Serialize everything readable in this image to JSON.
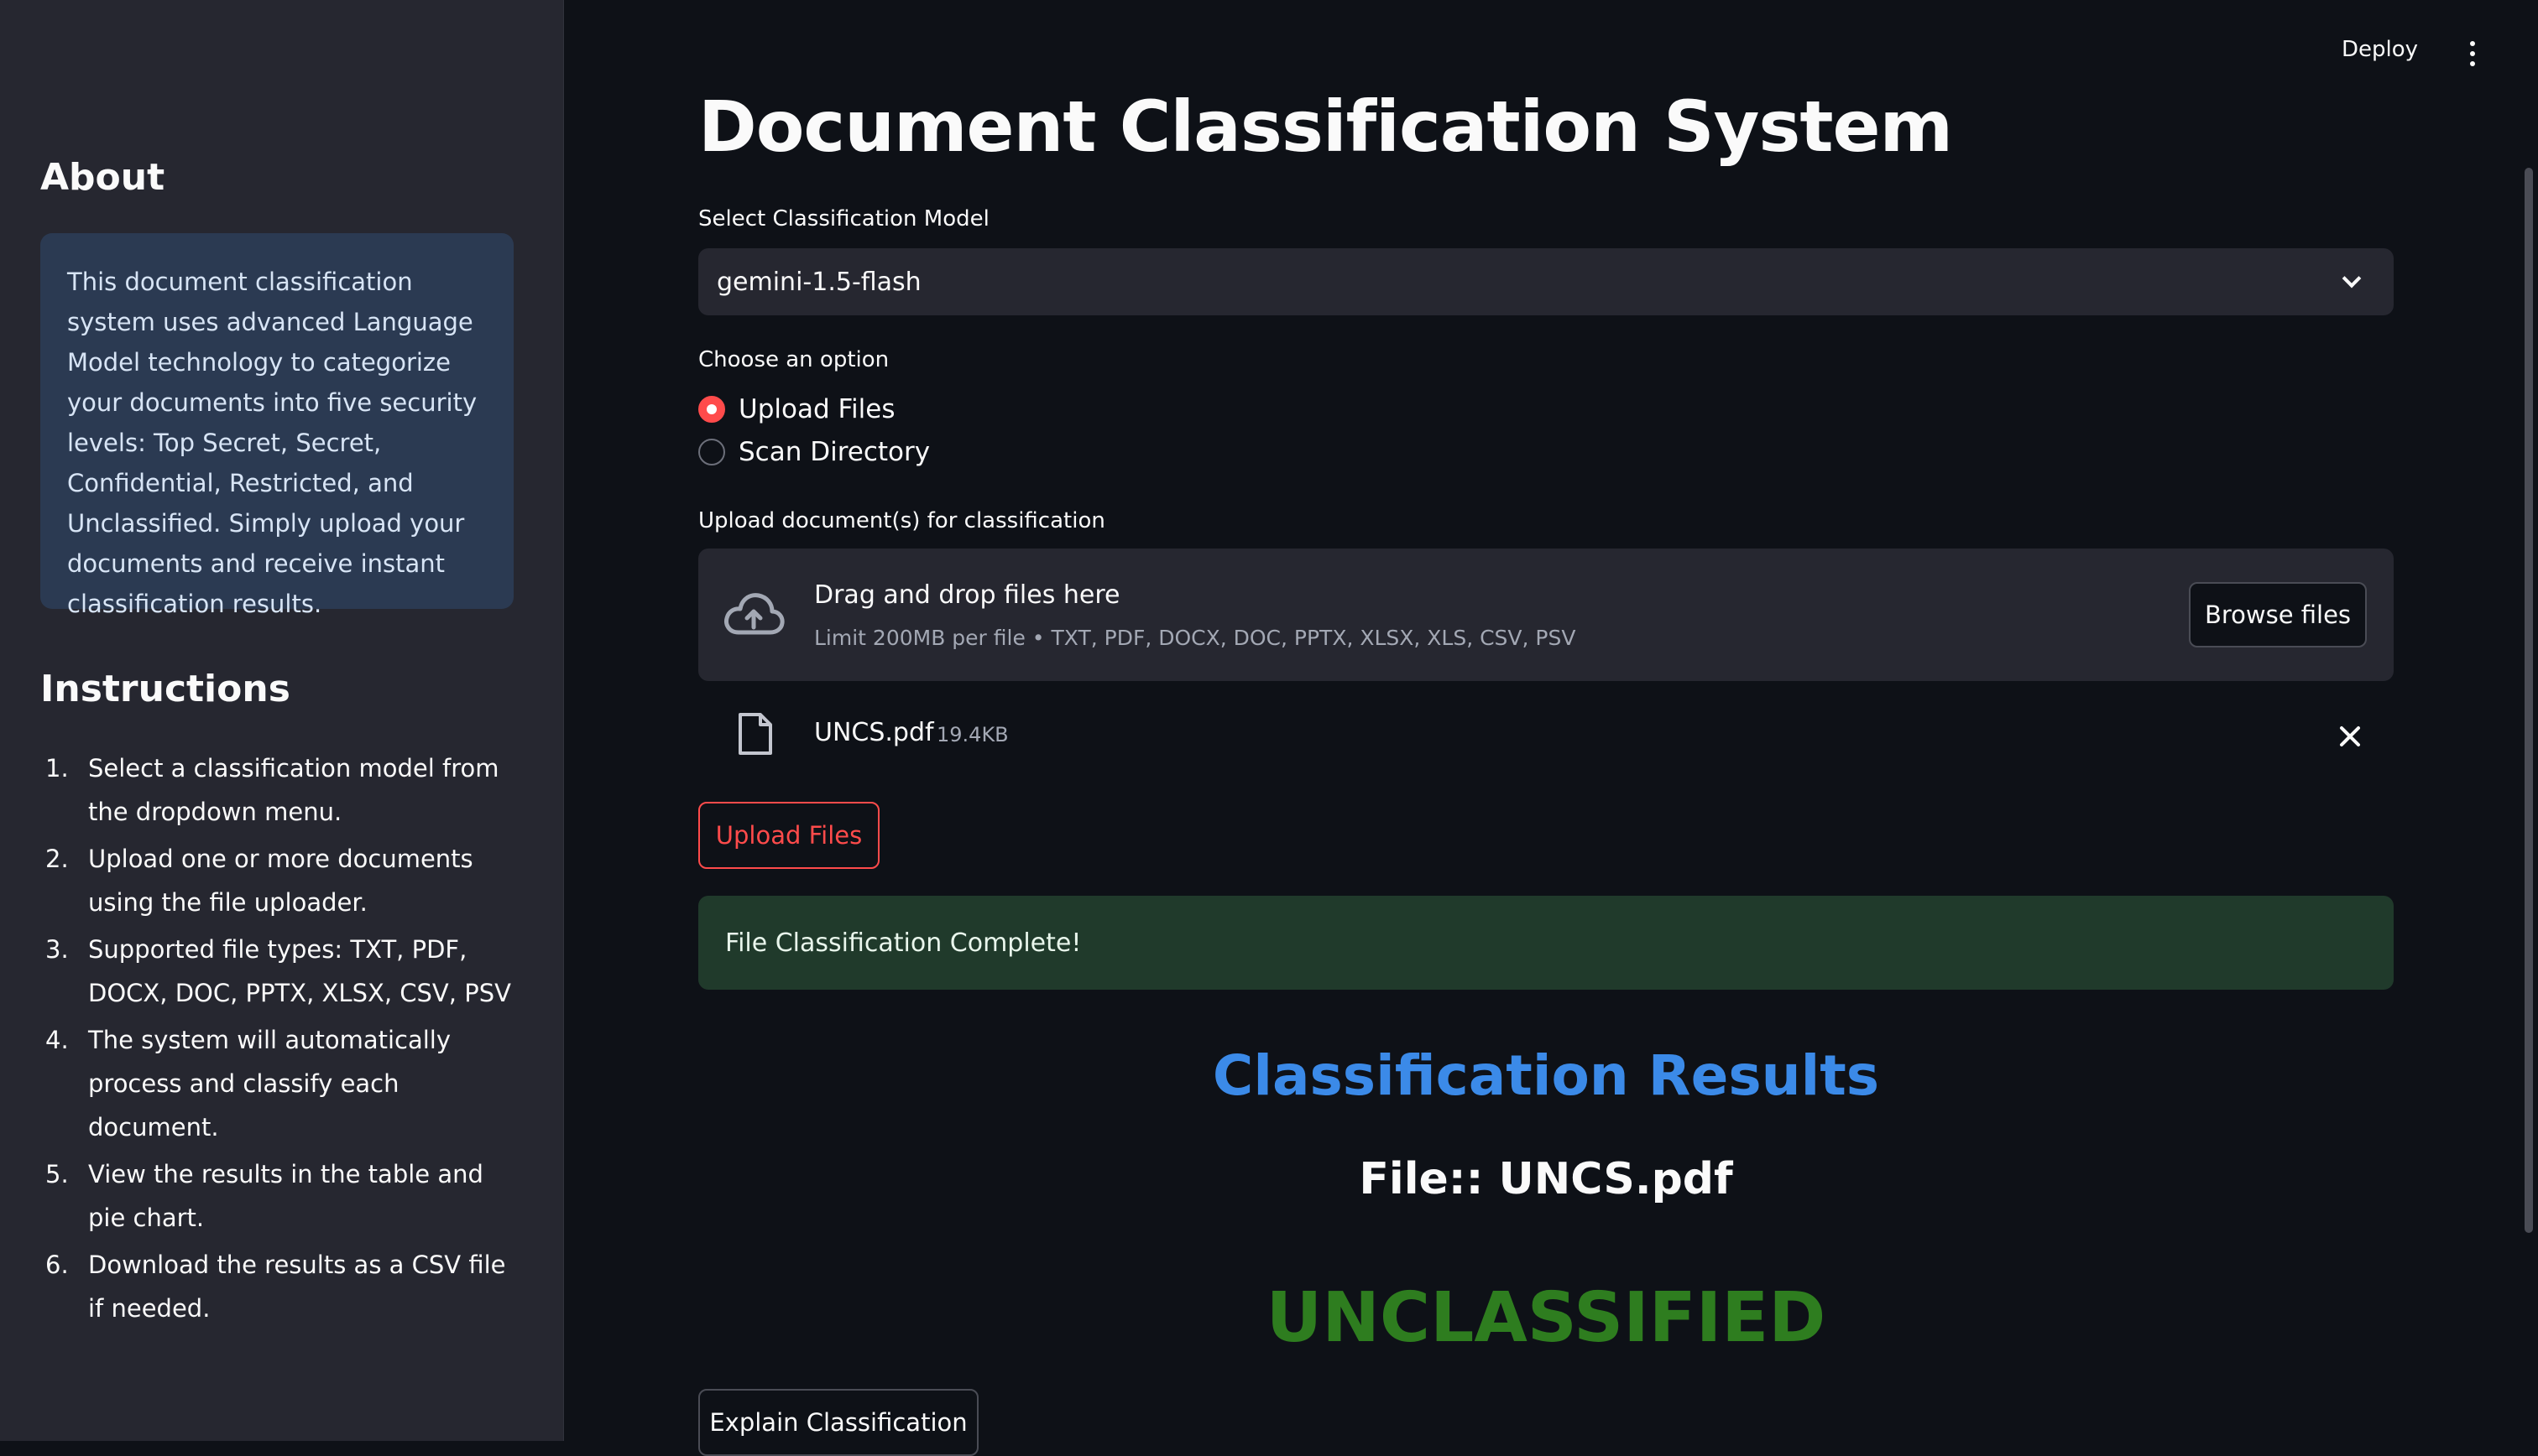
{
  "header": {
    "deploy_label": "Deploy",
    "menu_icon": "kebab-menu-icon"
  },
  "sidebar": {
    "about_title": "About",
    "about_text": "This document classification system uses advanced Language Model technology to categorize your documents into five security levels: Top Secret, Secret, Confidential, Restricted, and Unclassified. Simply upload your documents and receive instant classification results.",
    "instructions_title": "Instructions",
    "instructions": [
      {
        "num": "1.",
        "text": "Select a classification model from the dropdown menu."
      },
      {
        "num": "2.",
        "text": "Upload one or more documents using the file uploader."
      },
      {
        "num": "3.",
        "text": "Supported file types: TXT, PDF, DOCX, DOC, PPTX, XLSX, CSV, PSV"
      },
      {
        "num": "4.",
        "text": "The system will automatically process and classify each document."
      },
      {
        "num": "5.",
        "text": "View the results in the table and pie chart."
      },
      {
        "num": "6.",
        "text": "Download the results as a CSV file if needed."
      }
    ]
  },
  "main": {
    "title": "Document Classification System",
    "model_select": {
      "label": "Select Classification Model",
      "value": "gemini-1.5-flash"
    },
    "option": {
      "label": "Choose an option",
      "choices": [
        "Upload Files",
        "Scan Directory"
      ],
      "selected": "Upload Files"
    },
    "uploader": {
      "label": "Upload document(s) for classification",
      "drop_text": "Drag and drop files here",
      "limit_text": "Limit 200MB per file • TXT, PDF, DOCX, DOC, PPTX, XLSX, XLS, CSV, PSV",
      "browse_label": "Browse files"
    },
    "uploaded_file": {
      "name": "UNCS.pdf",
      "size": "19.4KB"
    },
    "upload_button": "Upload Files",
    "success_message": "File Classification Complete!",
    "results_title": "Classification Results",
    "file_line": "File:: UNCS.pdf",
    "classification": "UNCLASSIFIED",
    "explain_button": "Explain Classification"
  },
  "colors": {
    "accent": "#ff4b4b",
    "results_title": "#3b8ae8",
    "classification": "#2e7d1f",
    "success_bg": "#203a2b",
    "about_bg": "#2b3a52"
  }
}
